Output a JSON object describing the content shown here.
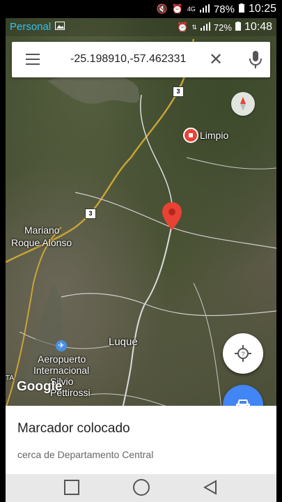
{
  "outer_status": {
    "battery": "78%",
    "time": "10:25",
    "network": "4G"
  },
  "inner_status": {
    "carrier": "Personal",
    "battery": "72%",
    "time": "10:48"
  },
  "search": {
    "query": "-25.198910,-57.462331"
  },
  "map": {
    "labels": {
      "limpio": "Limpio",
      "mariano": "Mariano",
      "roque": "Roque Alonso",
      "luque": "Luque",
      "aero1": "Aeropuerto",
      "aero2": "Internacional",
      "aero3": "Silvio",
      "aero4": "Pettirossi",
      "ta": "TA"
    },
    "route_shield_1": "3",
    "route_shield_2": "3",
    "logo": "Google"
  },
  "sheet": {
    "title": "Marcador colocado",
    "subtitle": "cerca de Departamento Central"
  },
  "colors": {
    "accent": "#4285f4",
    "pin": "#e94235",
    "carrier": "#2ec4f0"
  }
}
